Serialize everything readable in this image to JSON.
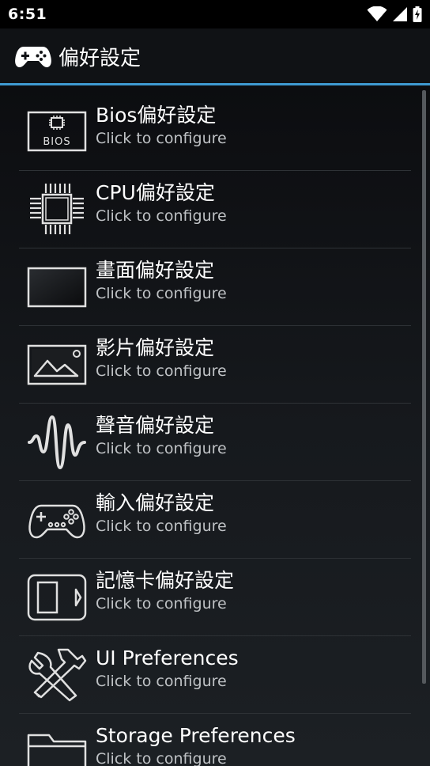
{
  "status_bar": {
    "time": "6:51"
  },
  "app_bar": {
    "title": "偏好設定",
    "icon": "gamepad-icon"
  },
  "items": [
    {
      "label": "Bios偏好設定",
      "subtitle": "Click to configure",
      "icon": "bios-chip-icon",
      "icon_text": "BIOS"
    },
    {
      "label": "CPU偏好設定",
      "subtitle": "Click to configure",
      "icon": "cpu-icon"
    },
    {
      "label": "畫面偏好設定",
      "subtitle": "Click to configure",
      "icon": "display-icon"
    },
    {
      "label": "影片偏好設定",
      "subtitle": "Click to configure",
      "icon": "image-icon"
    },
    {
      "label": "聲音偏好設定",
      "subtitle": "Click to configure",
      "icon": "waveform-icon"
    },
    {
      "label": "輸入偏好設定",
      "subtitle": "Click to configure",
      "icon": "gamepad-icon"
    },
    {
      "label": "記憶卡偏好設定",
      "subtitle": "Click to configure",
      "icon": "memory-card-icon"
    },
    {
      "label": "UI Preferences",
      "subtitle": "Click to configure",
      "icon": "tools-icon"
    },
    {
      "label": "Storage Preferences",
      "subtitle": "Click to configure",
      "icon": "folder-icon"
    }
  ],
  "colors": {
    "accent": "#3f9ad1",
    "app_bar": "#101215",
    "icon": "#e0e0e0"
  }
}
